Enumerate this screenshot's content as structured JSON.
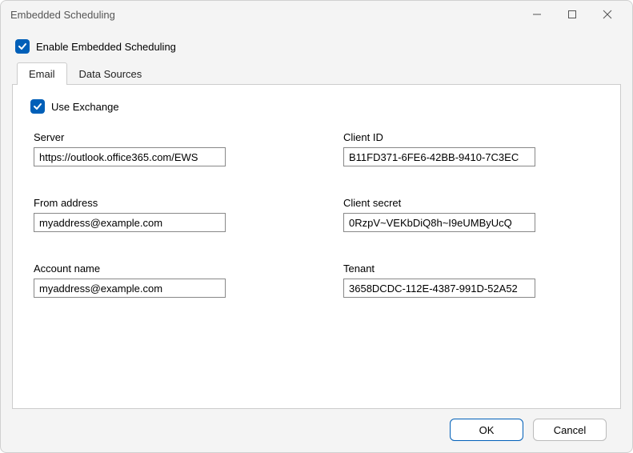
{
  "window": {
    "title": "Embedded Scheduling"
  },
  "enable": {
    "checked": true,
    "label": "Enable Embedded Scheduling"
  },
  "tabs": {
    "email": "Email",
    "dataSources": "Data Sources",
    "active": "email"
  },
  "useExchange": {
    "checked": true,
    "label": "Use Exchange"
  },
  "fields": {
    "server": {
      "label": "Server",
      "value": "https://outlook.office365.com/EWS"
    },
    "clientId": {
      "label": "Client ID",
      "value": "B11FD371-6FE6-42BB-9410-7C3EC"
    },
    "fromAddress": {
      "label": "From address",
      "value": "myaddress@example.com"
    },
    "clientSecret": {
      "label": "Client secret",
      "value": "0RzpV~VEKbDiQ8h~I9eUMByUcQ"
    },
    "accountName": {
      "label": "Account name",
      "value": "myaddress@example.com"
    },
    "tenant": {
      "label": "Tenant",
      "value": "3658DCDC-112E-4387-991D-52A52"
    }
  },
  "buttons": {
    "ok": "OK",
    "cancel": "Cancel"
  }
}
